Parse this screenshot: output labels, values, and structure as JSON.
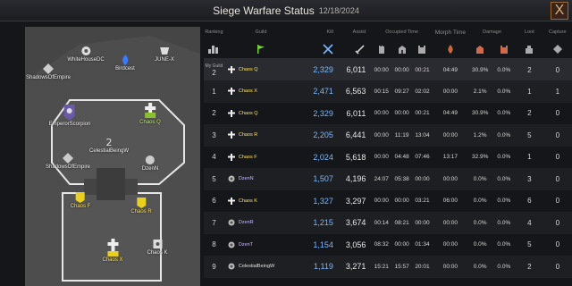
{
  "header": {
    "title": "Siege Warfare Status",
    "date": "12/18/2024",
    "close_label": "X"
  },
  "map": {
    "nodes": [
      {
        "label": "WhiteHouseDC",
        "color": "white"
      },
      {
        "label": "JUNE-X",
        "color": "white"
      },
      {
        "label": "ShadowsOfEmpire",
        "color": "white"
      },
      {
        "label": "Birdcest",
        "color": "white"
      },
      {
        "label": "EmperorScorpion",
        "color": "white"
      },
      {
        "label": "Chaos Q",
        "color": "green"
      },
      {
        "label": "CelestialBeingW",
        "color": "white"
      },
      {
        "label": "ShadowsOfEmpire",
        "color": "white"
      },
      {
        "label": "DzenN",
        "color": "white"
      },
      {
        "label": "Chaos F",
        "color": "yellow"
      },
      {
        "label": "Chaos R",
        "color": "yellow"
      },
      {
        "label": "Chaos X",
        "color": "yellow"
      },
      {
        "label": "Chaos K",
        "color": "white"
      }
    ]
  },
  "table": {
    "headers": {
      "ranking": "Ranking",
      "guild": "Guild",
      "kill": "Kill",
      "assist": "Assist",
      "occupied_time": "Occupied Time",
      "morph_time": "Morph Time",
      "damage": "Damage",
      "loot": "Loot",
      "capture": "Capture"
    },
    "my_guild_label": "My Guild",
    "my_guild": {
      "rank": "2",
      "guild": "Chaos Q",
      "kill": "2,329",
      "assist": "6,011",
      "o1": "00:00",
      "o2": "00:00",
      "o3": "00:21",
      "morph": "04:49",
      "d1": "30.9%",
      "d2": "0.0%",
      "loot": "2",
      "capture": "0"
    },
    "rows": [
      {
        "rank": "1",
        "guild": "Chaos X",
        "kill": "2,471",
        "assist": "6,563",
        "o1": "00:15",
        "o2": "09:27",
        "o3": "02:02",
        "morph": "00:00",
        "d1": "2.1%",
        "d2": "0.0%",
        "loot": "1",
        "capture": "1"
      },
      {
        "rank": "2",
        "guild": "Chaos Q",
        "kill": "2,329",
        "assist": "6,011",
        "o1": "00:00",
        "o2": "00:00",
        "o3": "00:21",
        "morph": "04:49",
        "d1": "30.9%",
        "d2": "0.0%",
        "loot": "2",
        "capture": "0"
      },
      {
        "rank": "3",
        "guild": "Chaos R",
        "kill": "2,205",
        "assist": "6,441",
        "o1": "00:00",
        "o2": "11:19",
        "o3": "13:04",
        "morph": "00:00",
        "d1": "1.2%",
        "d2": "0.0%",
        "loot": "5",
        "capture": "0"
      },
      {
        "rank": "4",
        "guild": "Chaos F",
        "kill": "2,024",
        "assist": "5,618",
        "o1": "00:00",
        "o2": "04:48",
        "o3": "07:46",
        "morph": "13:17",
        "d1": "32.9%",
        "d2": "0.0%",
        "loot": "1",
        "capture": "0"
      },
      {
        "rank": "5",
        "guild": "DzenN",
        "kill": "1,507",
        "assist": "4,196",
        "o1": "24:07",
        "o2": "05:38",
        "o3": "00:00",
        "morph": "00:00",
        "d1": "0.0%",
        "d2": "0.0%",
        "loot": "3",
        "capture": "0"
      },
      {
        "rank": "6",
        "guild": "Chaos K",
        "kill": "1,327",
        "assist": "3,297",
        "o1": "00:00",
        "o2": "00:00",
        "o3": "03:21",
        "morph": "06:00",
        "d1": "0.0%",
        "d2": "0.0%",
        "loot": "6",
        "capture": "0"
      },
      {
        "rank": "7",
        "guild": "DzenR",
        "kill": "1,215",
        "assist": "3,674",
        "o1": "00:14",
        "o2": "08:21",
        "o3": "00:00",
        "morph": "00:00",
        "d1": "0.0%",
        "d2": "0.0%",
        "loot": "4",
        "capture": "0"
      },
      {
        "rank": "8",
        "guild": "DzenT",
        "kill": "1,154",
        "assist": "3,056",
        "o1": "08:32",
        "o2": "00:00",
        "o3": "01:34",
        "morph": "00:00",
        "d1": "0.0%",
        "d2": "0.0%",
        "loot": "5",
        "capture": "0"
      },
      {
        "rank": "9",
        "guild": "CelestialBeingW",
        "kill": "1,119",
        "assist": "3,271",
        "o1": "15:21",
        "o2": "15:57",
        "o3": "20:01",
        "morph": "00:00",
        "d1": "0.0%",
        "d2": "0.0%",
        "loot": "2",
        "capture": "0"
      }
    ]
  },
  "colors": {
    "kill": "#7ab8ff",
    "chaos_guild": "#ffe24a",
    "dzen_guild": "#c8b8ff"
  }
}
